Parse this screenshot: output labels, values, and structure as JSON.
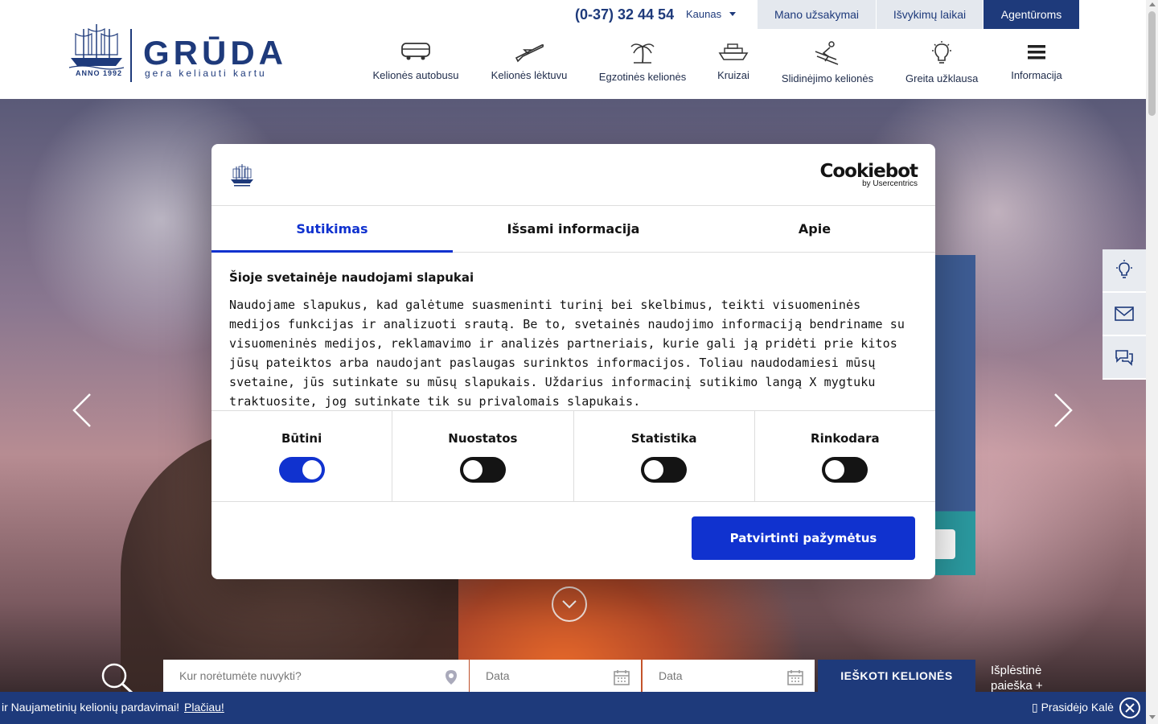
{
  "header": {
    "logo": {
      "word": "GRŪDA",
      "tagline": "gera keliauti kartu",
      "anno": "ANNO 1992"
    },
    "phone": "(0-37) 32 44 54",
    "city": "Kaunas",
    "top_buttons": [
      "Mano užsakymai",
      "Išvykimų laikai",
      "Agentūroms"
    ],
    "nav": [
      {
        "label": "Kelionės autobusu",
        "icon": "bus-icon"
      },
      {
        "label": "Kelionės lėktuvu",
        "icon": "plane-icon"
      },
      {
        "label": "Egzotinės kelionės",
        "icon": "palm-icon"
      },
      {
        "label": "Kruizai",
        "icon": "ship-icon"
      },
      {
        "label": "Slidinėjimo kelionės",
        "icon": "ski-icon"
      },
      {
        "label": "Greita užklausa",
        "icon": "lightbulb-icon"
      },
      {
        "label": "Informacija",
        "icon": "menu-icon"
      }
    ]
  },
  "search": {
    "destination_placeholder": "Kur norėtumėte nuvykti?",
    "date_from_placeholder": "Data",
    "date_to_placeholder": "Data",
    "button": "IEŠKOTI KELIONĖS",
    "advanced": "Išplėstinė paieška +"
  },
  "ticker": {
    "text": "ir Naujametinių kelionių pardavimai!",
    "link": "Plačiau!",
    "right_text": "Prasidėjo Kalė"
  },
  "cookie_dialog": {
    "brand": "Cookiebot",
    "brand_sub": "by Usercentrics",
    "tabs": [
      "Sutikimas",
      "Išsami informacija",
      "Apie"
    ],
    "active_tab": 0,
    "title": "Šioje svetainėje naudojami slapukai",
    "body": "Naudojame slapukus, kad galėtume suasmeninti turinį bei skelbimus, teikti visuomeninės medijos funkcijas ir analizuoti srautą. Be to, svetainės naudojimo informaciją bendriname su visuomeninės medijos, reklamavimo ir analizės partneriais, kurie gali ją pridėti prie kitos jūsų pateiktos arba naudojant paslaugas surinktos informacijos. Toliau naudodamiesi mūsų svetaine, jūs sutinkate su mūsų slapukais. Uždarius informacinį sutikimo langą X mygtuku traktuosite, jog sutinkate tik su privalomais slapukais.",
    "categories": [
      {
        "label": "Būtini",
        "on": true
      },
      {
        "label": "Nuostatos",
        "on": false
      },
      {
        "label": "Statistika",
        "on": false
      },
      {
        "label": "Rinkodara",
        "on": false
      }
    ],
    "confirm_button": "Patvirtinti pažymėtus"
  },
  "colors": {
    "brand": "#1e3a7b",
    "cookie_accent": "#1032cf"
  }
}
